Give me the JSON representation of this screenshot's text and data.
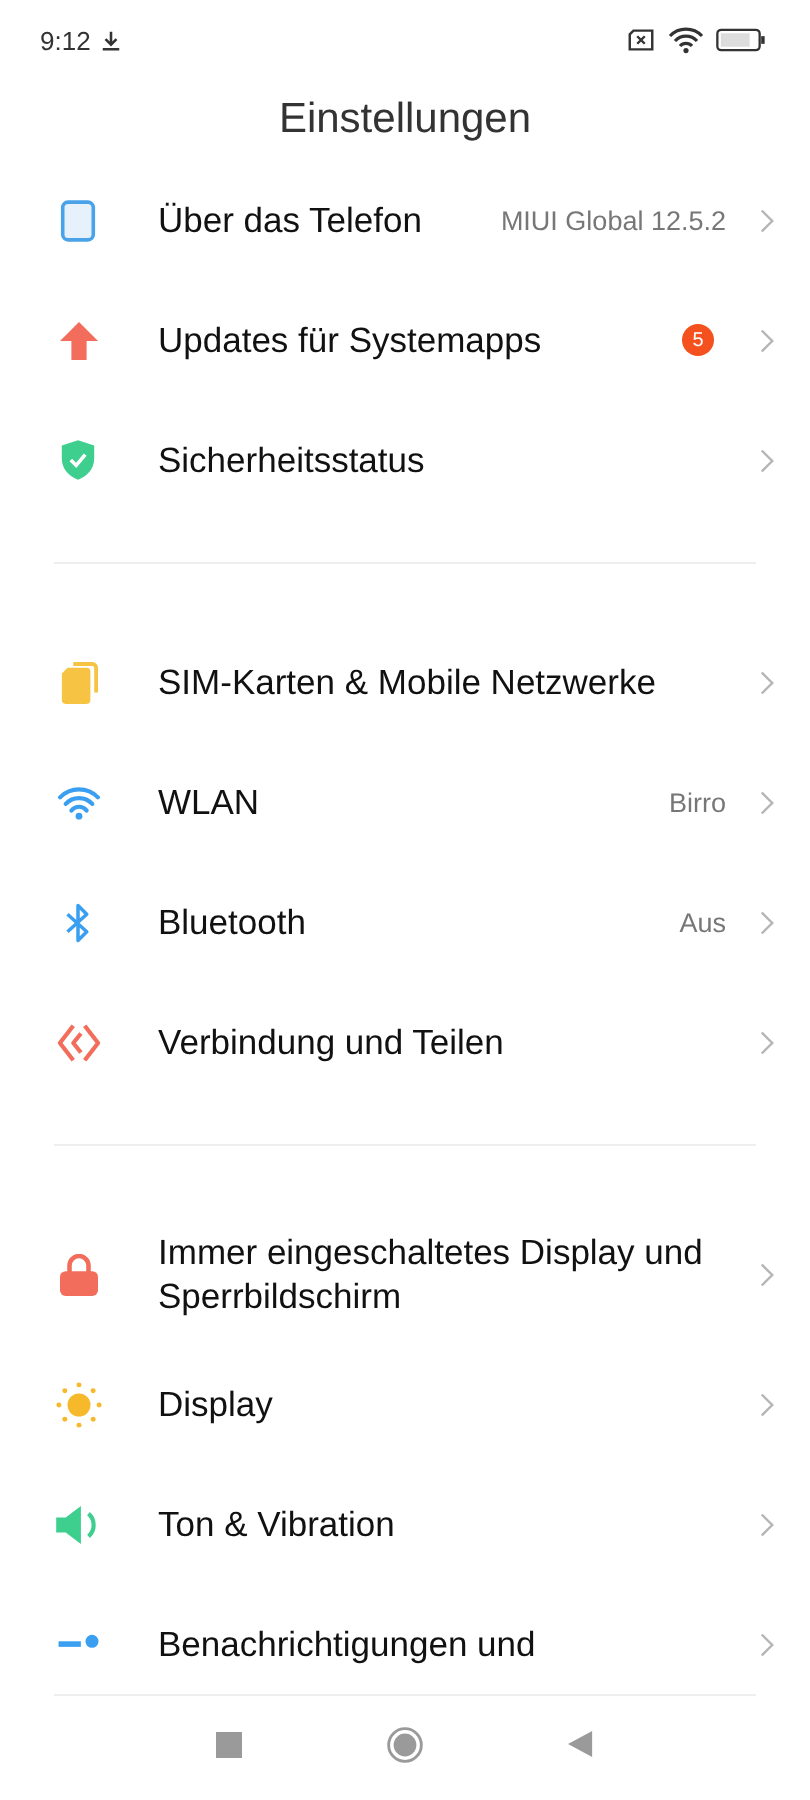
{
  "status_bar": {
    "time": "9:12"
  },
  "title": "Einstellungen",
  "groups": [
    {
      "items": [
        {
          "label": "Über das Telefon",
          "value": "MIUI Global 12.5.2"
        },
        {
          "label": "Updates für Systemapps",
          "badge": "5"
        },
        {
          "label": "Sicherheitsstatus"
        }
      ]
    },
    {
      "items": [
        {
          "label": "SIM-Karten & Mobile Netzwerke"
        },
        {
          "label": "WLAN",
          "value": "Birro"
        },
        {
          "label": "Bluetooth",
          "value": "Aus"
        },
        {
          "label": "Verbindung und Teilen"
        }
      ]
    },
    {
      "items": [
        {
          "label": "Immer eingeschaltetes Display und Sperrbildschirm"
        },
        {
          "label": "Display"
        },
        {
          "label": "Ton & Vibration"
        },
        {
          "label": "Benachrichtigungen und"
        }
      ]
    }
  ]
}
